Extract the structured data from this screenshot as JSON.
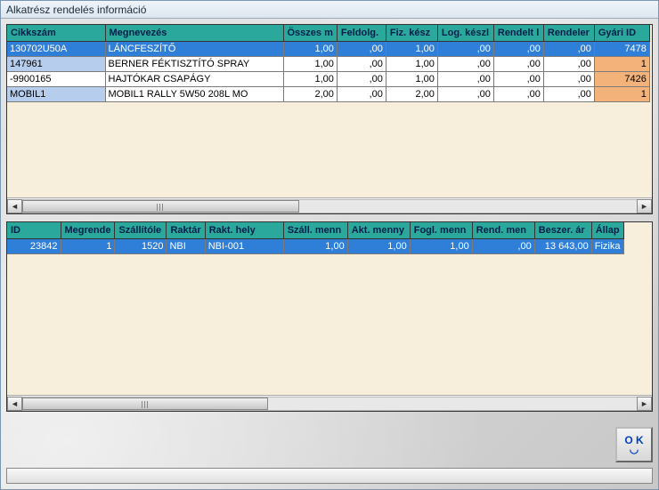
{
  "window": {
    "title": "Alkatrész rendelés információ"
  },
  "ok": {
    "label": "O K",
    "smile": "◡"
  },
  "grid1": {
    "headers": [
      "Cikkszám",
      "Megnevezés",
      "Összes m",
      "Feldolg.",
      "Fiz. kész",
      "Log. készl",
      "Rendelt l",
      "Rendeler",
      "Gyári ID"
    ],
    "widths": [
      110,
      200,
      55,
      55,
      58,
      63,
      56,
      57,
      62
    ],
    "rows": [
      {
        "sel": true,
        "key": "130702U50A",
        "name": "LÁNCFESZÍTŐ",
        "v": [
          "1,00",
          ",00",
          "1,00",
          ",00",
          ",00",
          ",00",
          "7478"
        ],
        "last_orange": false
      },
      {
        "hl": true,
        "key": "147961",
        "name": "BERNER FÉKTISZTÍTÓ SPRAY",
        "v": [
          "1,00",
          ",00",
          "1,00",
          ",00",
          ",00",
          ",00",
          "1"
        ],
        "last_orange": true
      },
      {
        "key": "-9900165",
        "name": "HAJTÓKAR CSAPÁGY",
        "v": [
          "1,00",
          ",00",
          "1,00",
          ",00",
          ",00",
          ",00",
          "7426"
        ],
        "last_orange": true
      },
      {
        "hl": true,
        "key": "MOBIL1",
        "name": "MOBIL1 RALLY 5W50 208L MO",
        "v": [
          "2,00",
          ",00",
          "2,00",
          ",00",
          ",00",
          ",00",
          "1"
        ],
        "last_orange": true
      }
    ]
  },
  "grid2": {
    "headers": [
      "ID",
      "Megrende",
      "Szállítóle",
      "Raktár",
      "Rakt. hely",
      "Száll. menn",
      "Akt. menny",
      "Fogl. menn",
      "Rend. men",
      "Beszer. ár",
      "Állap"
    ],
    "widths": [
      60,
      58,
      58,
      33,
      88,
      72,
      70,
      70,
      70,
      64,
      35
    ],
    "rows": [
      {
        "sel": true,
        "cells": [
          "23842",
          "1",
          "1520",
          "NBI",
          "NBI-001",
          "1,00",
          "1,00",
          "1,00",
          ",00",
          "13 643,00",
          "Fizika"
        ],
        "align": [
          "r",
          "r",
          "r",
          "l",
          "l",
          "r",
          "r",
          "r",
          "r",
          "r",
          "l"
        ]
      }
    ]
  }
}
